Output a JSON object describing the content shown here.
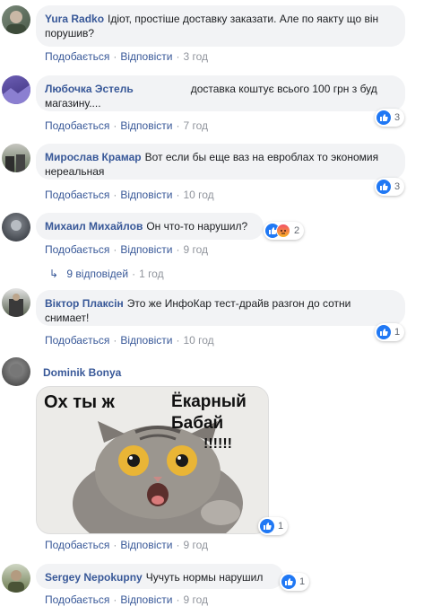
{
  "actions_labels": {
    "like": "Подобається",
    "reply": "Відповісти",
    "sep": "·"
  },
  "comments": [
    {
      "author": "Yura Radko",
      "text": "Ідіот, простіше доставку заказати. Але по яакту що він порушив?",
      "time": "3 год"
    },
    {
      "author": "Любочка Эстель",
      "text": "доставка коштує всього 100 грн з буд магазину....",
      "time": "7 год",
      "reactions": "3"
    },
    {
      "author": "Мирослав Крамар",
      "text": "Вот если бы еще ваз на евроблах то экономия нереальная",
      "time": "10 год",
      "reactions": "3"
    },
    {
      "author": "Михаил Михайлов",
      "text": "Он что-то нарушил?",
      "time": "9 год",
      "reactions": "2"
    },
    {
      "author": "Віктор Плаксін",
      "text": "Это же ИнфоКар тест-драйв разгон до сотни снимает!",
      "time": "10 год",
      "reactions": "1"
    },
    {
      "author": "Dominik Bonya",
      "text": "",
      "time": "9 год",
      "reactions": "1"
    },
    {
      "author": "Sergey Nepokupny",
      "text": "Чучуть нормы нарушил",
      "time": "9 год",
      "reactions": "1"
    }
  ],
  "replies": {
    "arrow": "↳",
    "label": "9 відповідей",
    "time": "1 год"
  },
  "meme": {
    "line1": "Ох ты ж",
    "line2": "Ёкарный",
    "line3": "Бабай",
    "line4": "!!!!!!"
  },
  "colors": {
    "link": "#385898",
    "bubble": "#f2f3f5",
    "like": "#2078f4",
    "muted": "#90949c"
  }
}
